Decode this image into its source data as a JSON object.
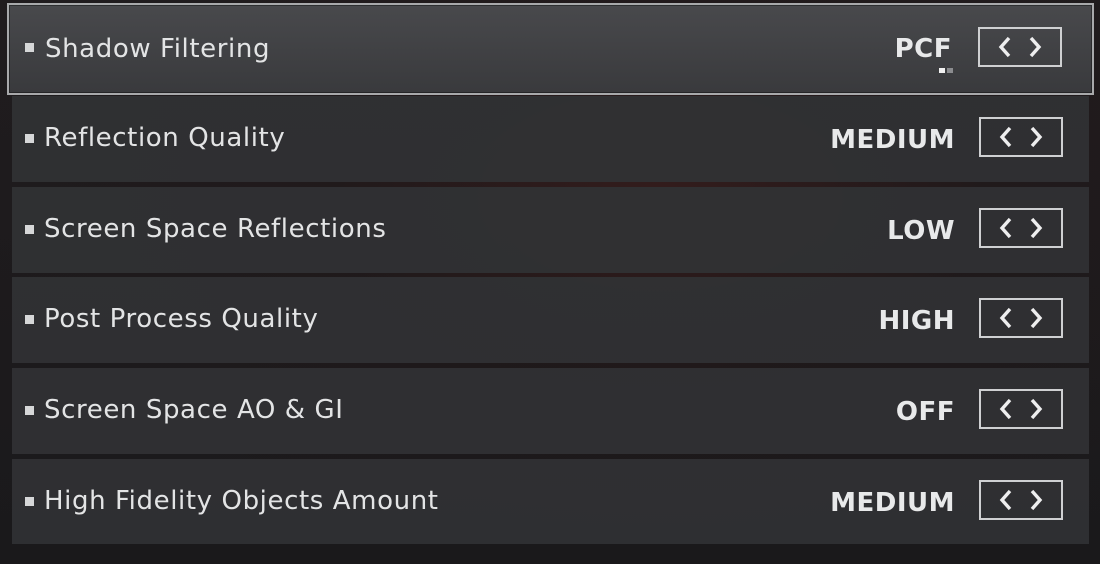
{
  "settings": [
    {
      "label": "Shadow Filtering",
      "value": "PCF",
      "selected": true
    },
    {
      "label": "Reflection Quality",
      "value": "MEDIUM",
      "selected": false
    },
    {
      "label": "Screen Space Reflections",
      "value": "LOW",
      "selected": false
    },
    {
      "label": "Post Process Quality",
      "value": "HIGH",
      "selected": false
    },
    {
      "label": "Screen Space AO & GI",
      "value": "OFF",
      "selected": false
    },
    {
      "label": "High Fidelity Objects Amount",
      "value": "MEDIUM",
      "selected": false
    }
  ],
  "icons": {
    "bullet": "square-bullet-icon",
    "prev": "chevron-left-icon",
    "next": "chevron-right-icon"
  },
  "value_indicator": {
    "current_option": 1,
    "option_count": 2
  },
  "colors": {
    "row_background": "#303134",
    "selected_row_background": "#46474a",
    "selected_border": "#a8a9ab",
    "text": "#e3e4e5",
    "stepper_border": "#cfd0d2"
  }
}
